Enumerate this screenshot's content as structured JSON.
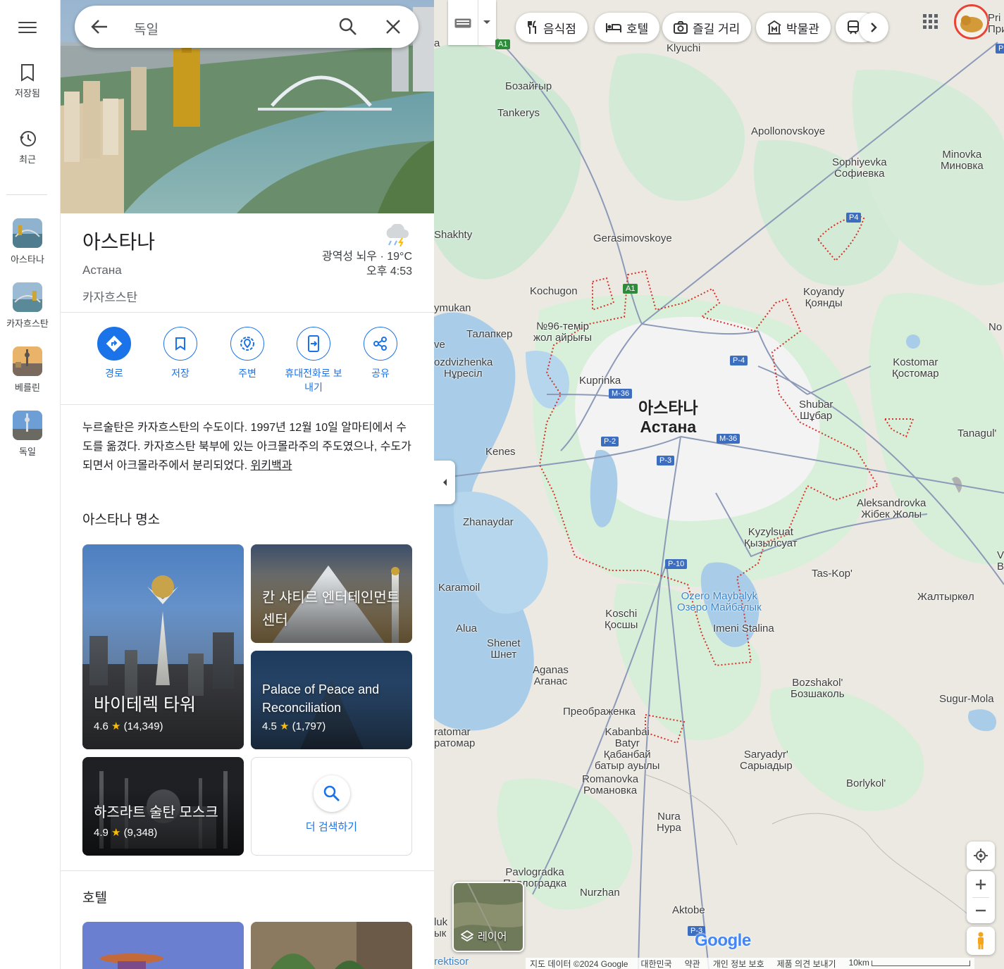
{
  "search": {
    "query": "독일"
  },
  "rail": {
    "saved": "저장됨",
    "recent": "최근",
    "history": [
      "아스타나",
      "카자흐스탄",
      "베를린",
      "독일"
    ]
  },
  "place": {
    "title": "아스타나",
    "subtitle": "Астана",
    "country": "카자흐스탄",
    "weather_desc": "광역성 뇌우 · 19°C",
    "weather_time": "오후 4:53"
  },
  "actions": [
    "경로",
    "저장",
    "주변",
    "휴대전화로 보",
    "내기",
    "공유"
  ],
  "description": "누르술탄은 카자흐스탄의 수도이다. 1997년 12월 10일 알마티에서 수도를 옮겼다. 카자흐스탄 북부에 있는 아크몰라주의 주도였으나, 수도가 되면서 아크몰라주에서 분리되었다.",
  "wiki_link": "위키백과",
  "attractions": {
    "heading": "아스타나 명소",
    "items": [
      {
        "name": "바이테렉 타워",
        "rating": "4.6",
        "reviews": "(14,349)"
      },
      {
        "name": "칸 샤티르 엔터테인먼트 센터"
      },
      {
        "name": "Palace of Peace and Reconciliation",
        "rating": "4.5",
        "reviews": "(1,797)"
      },
      {
        "name": "하즈라트 술탄 모스크",
        "rating": "4.9",
        "reviews": "(9,348)"
      }
    ],
    "more": "더 검색하기"
  },
  "hotels_heading": "호텔",
  "map": {
    "chips": [
      "음식점",
      "호텔",
      "즐길 거리",
      "박물관"
    ],
    "city_ko": "아스타나",
    "city_ru": "Астана",
    "layer_label": "레이어",
    "labels": {
      "klyuchi": "Klyuchi",
      "bozaigyr": "Бозайғыр",
      "tankerys": "Tankerys",
      "apollonovskoye": "Apollonovskoye",
      "sophiyevka": "Sophiyevka",
      "sophiyevka_ru": "Софиевка",
      "minovka": "Minovka",
      "minovka_ru": "Миновка",
      "shakhty": "Shakhty",
      "gerasimovskoye": "Gerasimovskoye",
      "kochugon": "Kochugon",
      "koyandy": "Koyandy",
      "koyandy_ru": "Қоянды",
      "ymukan": "ymukan",
      "talapker": "Талапкер",
      "no96": "№96-темір",
      "no96b": "жол айрығы",
      "no": "No",
      "vozdvizhenka": "ozdvizhenka",
      "nuresil": "Нұресіл",
      "kuprinka": "Kuprinka",
      "kostomar": "Kostomar",
      "kostomar_ru": "Қостомар",
      "shubar": "Shubar",
      "shubar_ru": "Шұбар",
      "tanagul": "Tanagul'",
      "kenes": "Kenes",
      "aleksandrovka": "Aleksandrovka",
      "zhibek": "Жібек Жолы",
      "zhanaydar": "Zhanaydar",
      "kyzylsuat": "Kyzylsuat",
      "kyzylsuat_ru": "Қызылсуат",
      "taskop": "Tas-Kop'",
      "karamoil": "Karamoil",
      "zhaltyrkol": "Жалтыркөл",
      "lake": "Ozero Maybalyk",
      "lake_ru": "Озеро Майбалык",
      "imeni": "Imeni Stalina",
      "kosshi": "Koschi",
      "kosshi_ru": "Қосшы",
      "alua": "Alua",
      "shenet": "Shenet",
      "shenet_ru": "Шнет",
      "aganas": "Aganas",
      "aganas_ru": "Аганас",
      "bozshakol": "Bozshakol'",
      "bozshakol_ru": "Бозшаколь",
      "sugurmola": "Sugur-Mola",
      "preobrazhenka": "Преображенка",
      "kabanbai": "Kabanbai",
      "batyr": "Batyr",
      "kabanbai_kz": "Қабанбай",
      "batyr_kz": "батыр ауылы",
      "ratomar": "ratomar",
      "ratomar_ru": "ратомар",
      "saryadyr": "Saryadyr'",
      "saryadyr_ru": "Сарыадыр",
      "romanovka": "Romanovka",
      "romanovka_ru": "Романовка",
      "borlykol": "Borlykol'",
      "nura": "Nura",
      "nura_ru": "Нура",
      "pavlogradka": "Pavlogradka",
      "pavlogradka_ru": "Павлоградка",
      "nurzhan": "Nurzhan",
      "aktobe": "Aktobe",
      "luk": "luk",
      "yk": "ык",
      "rektisor": "rektisor",
      "pri": "Pri",
      "pri2": "При",
      "v": "V",
      "bo": "Bo",
      "a": "a",
      "ve": "ve"
    },
    "shields": {
      "a1_top": "A1",
      "a1": "A1",
      "p4_top": "P4",
      "p4": "P-4",
      "m36_w": "M-36",
      "m36_e": "M-36",
      "p2": "P-2",
      "p3": "P-3",
      "p10": "P-10",
      "p3_s": "P-3",
      "p_right": "P"
    },
    "logo": "Google",
    "footer": [
      "지도 데이터 ©2024 Google",
      "대한민국",
      "약관",
      "개인 정보 보호",
      "제품 의견 보내기",
      "10km"
    ]
  }
}
